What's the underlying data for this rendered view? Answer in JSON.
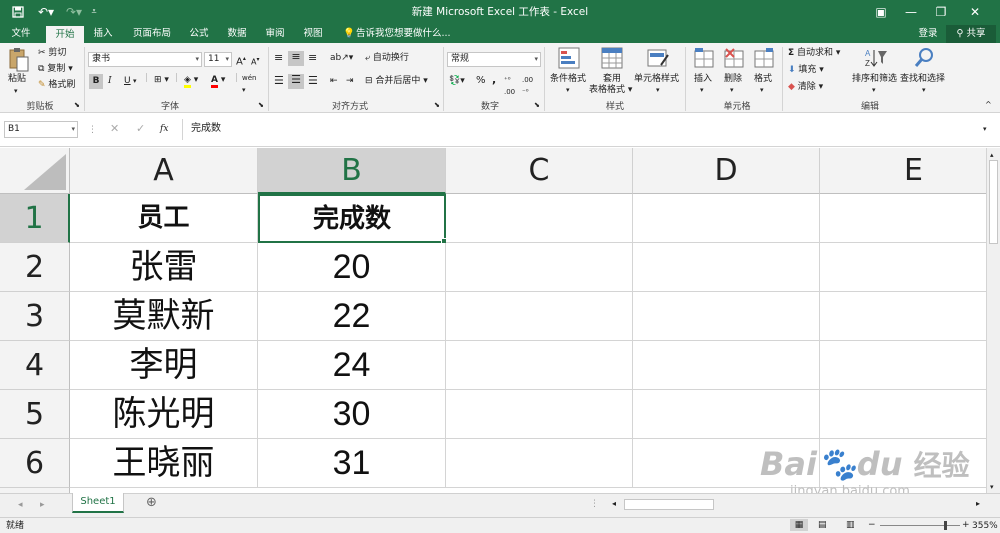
{
  "window": {
    "title": "新建 Microsoft Excel 工作表 - Excel",
    "login": "登录",
    "share": "共享"
  },
  "tabs": [
    "文件",
    "开始",
    "插入",
    "页面布局",
    "公式",
    "数据",
    "审阅",
    "视图"
  ],
  "active_tab": "开始",
  "tell_me": "告诉我您想要做什么...",
  "ribbon": {
    "clipboard": {
      "paste": "粘贴",
      "cut": "剪切",
      "copy": "复制",
      "painter": "格式刷",
      "label": "剪贴板"
    },
    "font": {
      "name": "隶书",
      "size": "11",
      "bold": "B",
      "italic": "I",
      "underline": "U",
      "label": "字体",
      "grow": "A",
      "shrink": "A",
      "wen": "wén"
    },
    "alignment": {
      "wrap": "自动换行",
      "merge": "合并后居中",
      "label": "对齐方式"
    },
    "number": {
      "format": "常规",
      "percent": "%",
      "comma": ",",
      "label": "数字"
    },
    "styles": {
      "conditional": "条件格式",
      "table_line1": "套用",
      "table_line2": "表格格式",
      "cell_styles": "单元格样式",
      "label": "样式"
    },
    "cells": {
      "insert": "插入",
      "delete": "删除",
      "format": "格式",
      "label": "单元格"
    },
    "editing": {
      "autosum": "自动求和",
      "fill": "填充",
      "clear": "清除",
      "sort": "排序和筛选",
      "find": "查找和选择",
      "label": "编辑"
    }
  },
  "formula_bar": {
    "name_box": "B1",
    "fx": "fx",
    "content": "完成数"
  },
  "columns": [
    "A",
    "B",
    "C",
    "D",
    "E"
  ],
  "rows": [
    {
      "num": "1",
      "a": "员工",
      "b": "完成数"
    },
    {
      "num": "2",
      "a": "张雷",
      "b": "20"
    },
    {
      "num": "3",
      "a": "莫默新",
      "b": "22"
    },
    {
      "num": "4",
      "a": "李明",
      "b": "24"
    },
    {
      "num": "5",
      "a": "陈光明",
      "b": "30"
    },
    {
      "num": "6",
      "a": "王晓丽",
      "b": "31"
    }
  ],
  "sheet_tab": "Sheet1",
  "status": {
    "ready": "就绪",
    "zoom": "355%"
  },
  "watermark": {
    "brand": "Bai",
    "du": "du",
    "jingyan": "经验",
    "url": "jingyan.baidu.com"
  },
  "colors": {
    "excel_green": "#217346",
    "ribbon_bg": "#f3f3f3",
    "header_bg": "#f3f3f3",
    "selected_header": "#d2d2d2"
  }
}
